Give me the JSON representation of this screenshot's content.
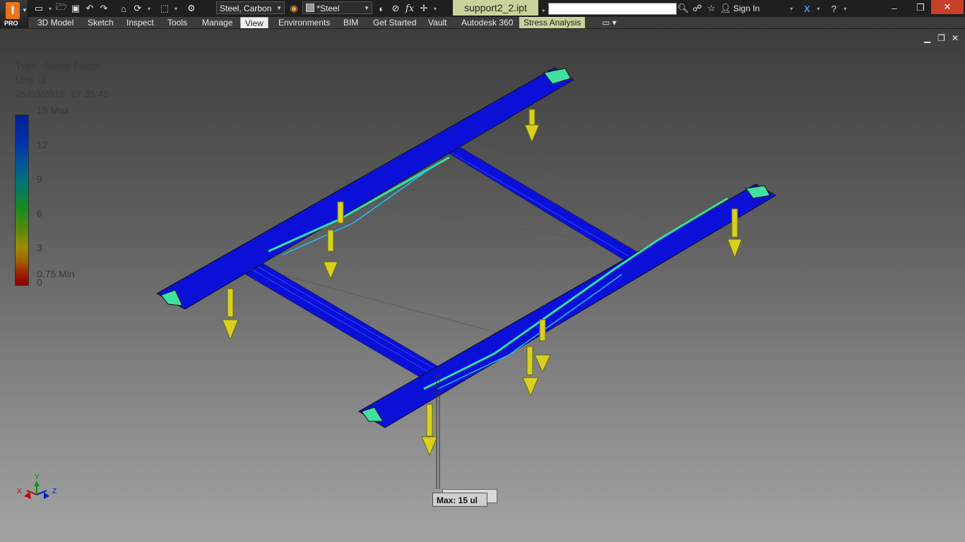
{
  "app": {
    "logo_letter": "I",
    "edition": "PRO"
  },
  "toolbar": {
    "material": "Steel, Carbon",
    "appearance": "*Steel",
    "document_title": "support2_2.ipt",
    "sign_in": "Sign In",
    "fx_label": "fx"
  },
  "ribbon": {
    "tabs": [
      {
        "label": "3D Model"
      },
      {
        "label": "Sketch"
      },
      {
        "label": "Inspect"
      },
      {
        "label": "Tools"
      },
      {
        "label": "Manage"
      },
      {
        "label": "View"
      },
      {
        "label": "Environments"
      },
      {
        "label": "BIM"
      },
      {
        "label": "Get Started"
      },
      {
        "label": "Vault"
      },
      {
        "label": "Autodesk 360"
      },
      {
        "label": "Stress Analysis"
      }
    ],
    "active_tab": "View",
    "contextual_tab": "Stress Analysis"
  },
  "legend": {
    "type": "Type: Safety Factor",
    "unit": "Unit: ul",
    "timestamp": "25/03/2018, 17:35:45",
    "ticks": [
      "15 Max",
      "12",
      "9",
      "6",
      "3",
      "0.75 Min",
      "0"
    ]
  },
  "probe": {
    "label": "Max: 15 ul"
  },
  "triad": {
    "x": "X",
    "y": "Y",
    "z": "Z"
  },
  "colors": {
    "doc_title_bg": "#c7d39a",
    "stress_tab_bg": "#c7d39a",
    "mesh_blue": "#0a10d8",
    "constraint_yellow": "#d8d020"
  }
}
